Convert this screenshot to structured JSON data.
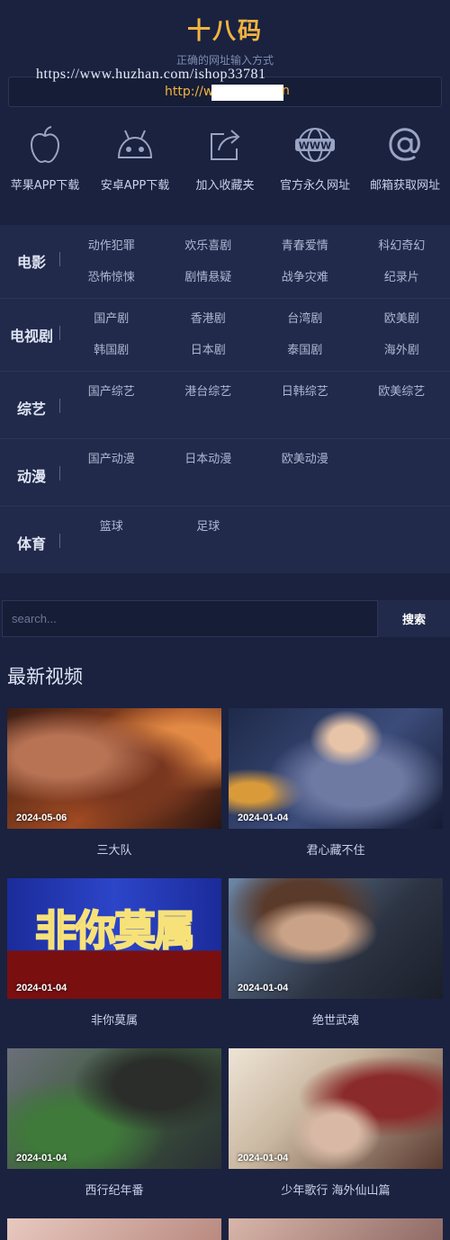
{
  "header": {
    "title": "十八码",
    "subtitle": "正确的网址输入方式",
    "watermark": "https://www.huzhan.com/ishop33781",
    "url_prefix": "http://w",
    "url_suffix": "n"
  },
  "shortcuts": [
    {
      "label": "苹果APP下载",
      "icon": "apple-icon"
    },
    {
      "label": "安卓APP下载",
      "icon": "android-icon"
    },
    {
      "label": "加入收藏夹",
      "icon": "share-icon"
    },
    {
      "label": "官方永久网址",
      "icon": "www-globe-icon"
    },
    {
      "label": "邮箱获取网址",
      "icon": "at-icon"
    }
  ],
  "categories": [
    {
      "name": "电影",
      "items": [
        "动作犯罪",
        "欢乐喜剧",
        "青春爱情",
        "科幻奇幻",
        "恐怖惊悚",
        "剧情悬疑",
        "战争灾难",
        "纪录片"
      ]
    },
    {
      "name": "电视剧",
      "items": [
        "国产剧",
        "香港剧",
        "台湾剧",
        "欧美剧",
        "韩国剧",
        "日本剧",
        "泰国剧",
        "海外剧"
      ]
    },
    {
      "name": "综艺",
      "items": [
        "国产综艺",
        "港台综艺",
        "日韩综艺",
        "欧美综艺"
      ]
    },
    {
      "name": "动漫",
      "items": [
        "国产动漫",
        "日本动漫",
        "欧美动漫"
      ]
    },
    {
      "name": "体育",
      "items": [
        "篮球",
        "足球"
      ]
    }
  ],
  "search": {
    "placeholder": "search...",
    "button": "搜索"
  },
  "section_title": "最新视频",
  "videos": [
    {
      "title": "三大队",
      "date": "2024-05-06"
    },
    {
      "title": "君心藏不住",
      "date": "2024-01-04"
    },
    {
      "title": "非你莫属",
      "date": "2024-01-04",
      "poster_text": "非你莫属"
    },
    {
      "title": "绝世武魂",
      "date": "2024-01-04"
    },
    {
      "title": "西行纪年番",
      "date": "2024-01-04"
    },
    {
      "title": "少年歌行 海外仙山篇",
      "date": "2024-01-04"
    }
  ],
  "colors": {
    "background": "#1a2240",
    "panel": "#212a4a",
    "accent": "#f2b440",
    "text": "#c9d1e8"
  }
}
